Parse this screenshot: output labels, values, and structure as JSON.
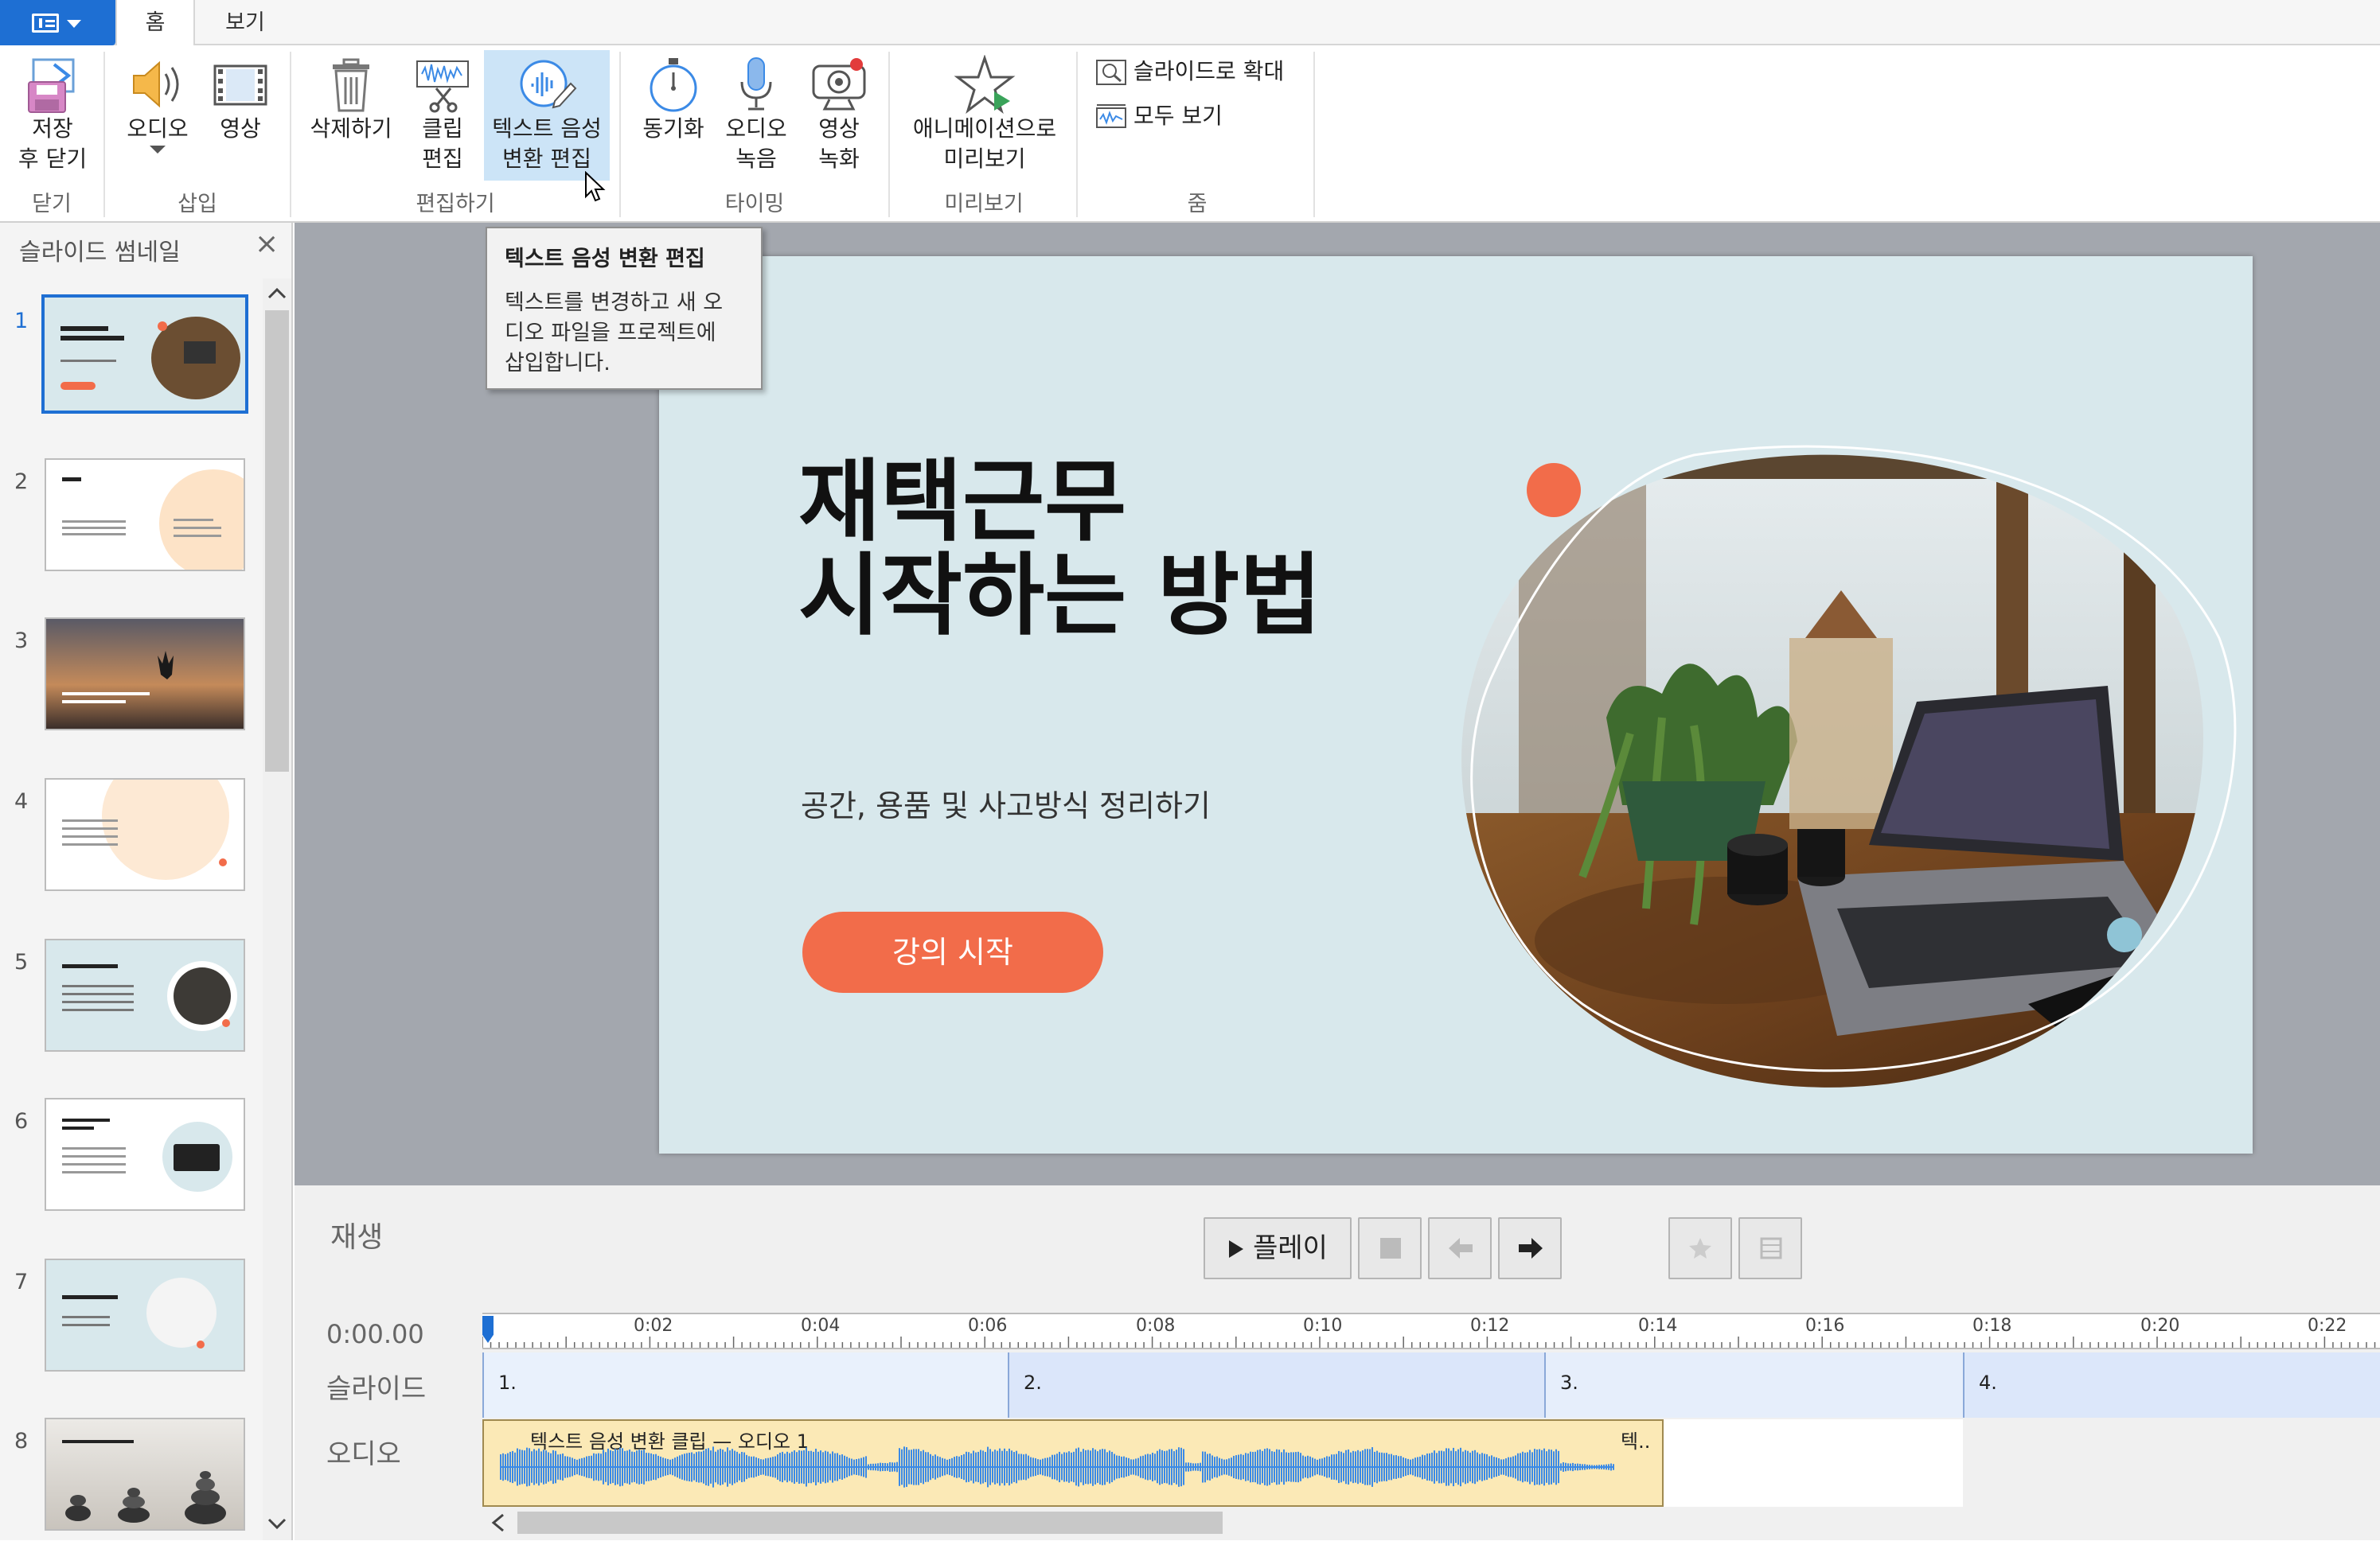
{
  "tabs": {
    "home": "홈",
    "view": "보기"
  },
  "ribbon": {
    "save_close": "저장\n후 닫기",
    "audio": "오디오",
    "video": "영상",
    "delete": "삭제하기",
    "clip_edit": "클립\n편집",
    "tts_edit": "텍스트 음성\n변환 편집",
    "sync": "동기화",
    "audio_record": "오디오\n녹음",
    "video_record": "영상\n녹화",
    "anim_preview": "애니메이션으로\n미리보기",
    "zoom_slide": "슬라이드로 확대",
    "view_all": "모두 보기",
    "groups": {
      "close": "닫기",
      "insert": "삽입",
      "edit": "편집하기",
      "timing": "타이밍",
      "preview": "미리보기",
      "zoom": "줌"
    }
  },
  "tooltip": {
    "title": "텍스트 음성 변환 편집",
    "body": "텍스트를 변경하고 새 오\n디오 파일을 프로젝트에\n삽입합니다."
  },
  "left_panel": {
    "title": "슬라이드 썸네일",
    "slides": [
      "1",
      "2",
      "3",
      "4",
      "5",
      "6",
      "7",
      "8"
    ]
  },
  "slide": {
    "title": "재택근무\n시작하는 방법",
    "subtitle": "공간, 용품 및 사고방식 정리하기",
    "button": "강의 시작"
  },
  "timeline": {
    "title": "재생",
    "play": "플레이",
    "time": "0:00.00",
    "row_slide": "슬라이드",
    "row_audio": "오디오",
    "ticks": [
      "0:02",
      "0:04",
      "0:06",
      "0:08",
      "0:10",
      "0:12",
      "0:14",
      "0:16",
      "0:18",
      "0:20",
      "0:22"
    ],
    "segments": [
      "1.",
      "2.",
      "3.",
      "4."
    ],
    "clip_label": "텍스트 음성 변환 클립 — 오디오 1",
    "clip_label_short": "텍.."
  },
  "colors": {
    "accent": "#1e6fd3",
    "slide_bg": "#d8e8ec",
    "cta": "#f26c4a",
    "clip": "#fbe9b6",
    "wave": "#3b8ae6"
  }
}
